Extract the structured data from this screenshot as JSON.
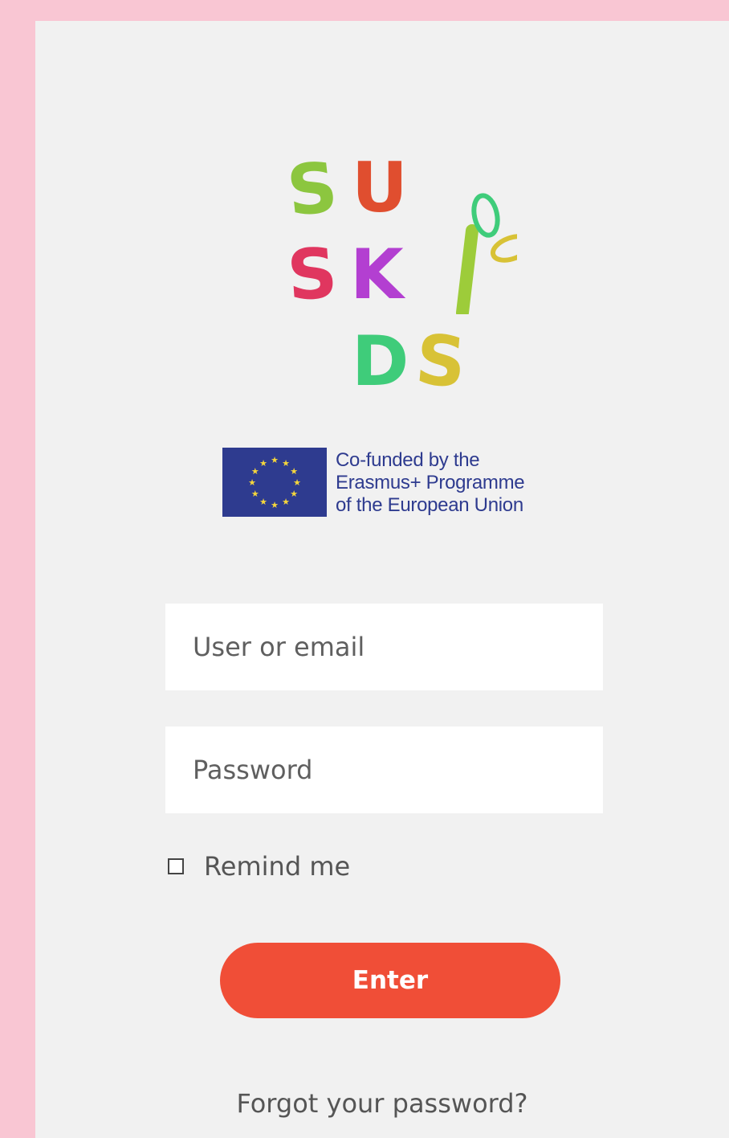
{
  "logo": {
    "letters": [
      "S",
      "U",
      "S",
      "K",
      "I",
      "D",
      "S"
    ]
  },
  "eu_badge": {
    "line1": "Co-funded by the",
    "line2": "Erasmus+ Programme",
    "line3": "of the European Union",
    "flag_color": "#2e3b8f",
    "star_color": "#f5d63c"
  },
  "form": {
    "user_placeholder": "User or email",
    "password_placeholder": "Password",
    "remember_label": "Remind me",
    "remember_checked": false,
    "submit_label": "Enter",
    "forgot_label": "Forgot your password?"
  },
  "colors": {
    "page_background": "#f9c6d3",
    "panel_background": "#f1f1f1",
    "button": "#f04e37"
  }
}
